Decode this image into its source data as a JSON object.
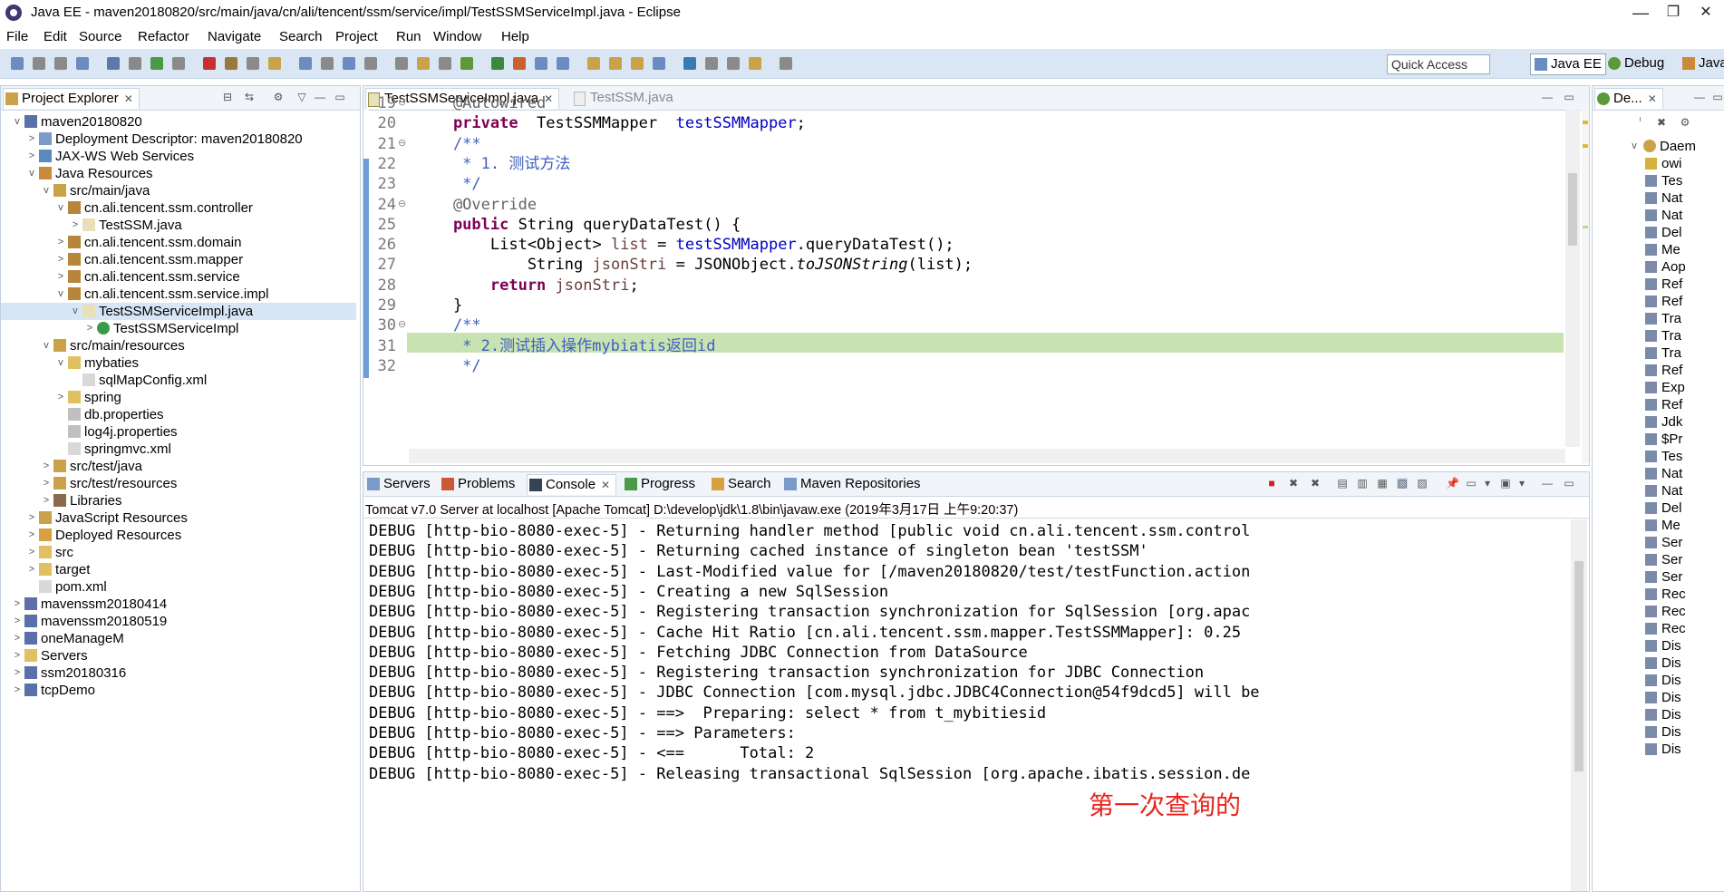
{
  "window": {
    "title": "Java EE - maven20180820/src/main/java/cn/ali/tencent/ssm/service/impl/TestSSMServiceImpl.java - Eclipse",
    "min": "—",
    "max": "❐",
    "close": "✕"
  },
  "menubar": [
    "File",
    "Edit",
    "Source",
    "Refactor",
    "Navigate",
    "Search",
    "Project",
    "Run",
    "Window",
    "Help"
  ],
  "toolbar": {
    "quick_access_placeholder": "Quick Access",
    "perspectives": [
      "Java EE",
      "Debug",
      "Java"
    ]
  },
  "explorer": {
    "title": "Project Explorer",
    "nodes": [
      {
        "label": "maven20180820",
        "depth": 0,
        "expand": "v",
        "icon": "project-icon"
      },
      {
        "label": "Deployment Descriptor: maven20180820",
        "depth": 1,
        "expand": ">",
        "icon": "deployment-icon"
      },
      {
        "label": "JAX-WS Web Services",
        "depth": 1,
        "expand": ">",
        "icon": "webservice-icon"
      },
      {
        "label": "Java Resources",
        "depth": 1,
        "expand": "v",
        "icon": "java-resources-icon"
      },
      {
        "label": "src/main/java",
        "depth": 2,
        "expand": "v",
        "icon": "source-folder-icon"
      },
      {
        "label": "cn.ali.tencent.ssm.controller",
        "depth": 3,
        "expand": "v",
        "icon": "package-icon"
      },
      {
        "label": "TestSSM.java",
        "depth": 4,
        "expand": ">",
        "icon": "java-file-icon"
      },
      {
        "label": "cn.ali.tencent.ssm.domain",
        "depth": 3,
        "expand": ">",
        "icon": "package-icon"
      },
      {
        "label": "cn.ali.tencent.ssm.mapper",
        "depth": 3,
        "expand": ">",
        "icon": "package-icon"
      },
      {
        "label": "cn.ali.tencent.ssm.service",
        "depth": 3,
        "expand": ">",
        "icon": "package-icon"
      },
      {
        "label": "cn.ali.tencent.ssm.service.impl",
        "depth": 3,
        "expand": "v",
        "icon": "package-icon"
      },
      {
        "label": "TestSSMServiceImpl.java",
        "depth": 4,
        "expand": "v",
        "icon": "java-file-icon",
        "selected": true
      },
      {
        "label": "TestSSMServiceImpl",
        "depth": 5,
        "expand": ">",
        "icon": "class-icon"
      },
      {
        "label": "src/main/resources",
        "depth": 2,
        "expand": "v",
        "icon": "source-folder-icon"
      },
      {
        "label": "mybaties",
        "depth": 3,
        "expand": "v",
        "icon": "folder-icon"
      },
      {
        "label": "sqlMapConfig.xml",
        "depth": 4,
        "expand": "",
        "icon": "xml-file-icon"
      },
      {
        "label": "spring",
        "depth": 3,
        "expand": ">",
        "icon": "folder-icon"
      },
      {
        "label": "db.properties",
        "depth": 3,
        "expand": "",
        "icon": "properties-file-icon"
      },
      {
        "label": "log4j.properties",
        "depth": 3,
        "expand": "",
        "icon": "properties-file-icon"
      },
      {
        "label": "springmvc.xml",
        "depth": 3,
        "expand": "",
        "icon": "xml-file-icon"
      },
      {
        "label": "src/test/java",
        "depth": 2,
        "expand": ">",
        "icon": "source-folder-icon"
      },
      {
        "label": "src/test/resources",
        "depth": 2,
        "expand": ">",
        "icon": "source-folder-icon"
      },
      {
        "label": "Libraries",
        "depth": 2,
        "expand": ">",
        "icon": "library-icon"
      },
      {
        "label": "JavaScript Resources",
        "depth": 1,
        "expand": ">",
        "icon": "javascript-icon"
      },
      {
        "label": "Deployed Resources",
        "depth": 1,
        "expand": ">",
        "icon": "deployed-icon"
      },
      {
        "label": "src",
        "depth": 1,
        "expand": ">",
        "icon": "folder-icon"
      },
      {
        "label": "target",
        "depth": 1,
        "expand": ">",
        "icon": "folder-icon"
      },
      {
        "label": "pom.xml",
        "depth": 1,
        "expand": "",
        "icon": "xml-file-icon"
      },
      {
        "label": "mavenssm20180414",
        "depth": 0,
        "expand": ">",
        "icon": "project-icon"
      },
      {
        "label": "mavenssm20180519",
        "depth": 0,
        "expand": ">",
        "icon": "project-icon"
      },
      {
        "label": "oneManageM",
        "depth": 0,
        "expand": ">",
        "icon": "project-icon"
      },
      {
        "label": "Servers",
        "depth": 0,
        "expand": ">",
        "icon": "folder-icon"
      },
      {
        "label": "ssm20180316",
        "depth": 0,
        "expand": ">",
        "icon": "project-icon"
      },
      {
        "label": "tcpDemo",
        "depth": 0,
        "expand": ">",
        "icon": "project-icon"
      }
    ]
  },
  "editor": {
    "tabs": [
      {
        "label": "TestSSMServiceImpl.java",
        "close": "✕",
        "active": true
      },
      {
        "label": "TestSSM.java",
        "close": "",
        "active": false
      }
    ],
    "lines": [
      {
        "n": "19",
        "fold": "⊖",
        "segs": [
          [
            "ann",
            "    @Autowired"
          ]
        ]
      },
      {
        "n": "20",
        "fold": "",
        "segs": [
          [
            "kw",
            "    private"
          ],
          [
            "",
            "  TestSSMMapper  "
          ],
          [
            "fld",
            "testSSMMapper"
          ],
          [
            "",
            ";"
          ]
        ]
      },
      {
        "n": "21",
        "fold": "⊖",
        "segs": [
          [
            "cmt",
            "    /**"
          ]
        ]
      },
      {
        "n": "22",
        "fold": "",
        "segs": [
          [
            "cmt",
            "     * 1. 测试方法"
          ]
        ]
      },
      {
        "n": "23",
        "fold": "",
        "segs": [
          [
            "cmt",
            "     */"
          ]
        ]
      },
      {
        "n": "24",
        "fold": "⊖",
        "segs": [
          [
            "ann",
            "    @Override"
          ]
        ]
      },
      {
        "n": "25",
        "fold": "",
        "segs": [
          [
            "kw",
            "    public"
          ],
          [
            "",
            " String queryDataTest() {"
          ]
        ]
      },
      {
        "n": "26",
        "fold": "",
        "segs": [
          [
            "",
            "        List<Object> "
          ],
          [
            "lvar",
            "list"
          ],
          [
            "",
            " = "
          ],
          [
            "fld",
            "testSSMMapper"
          ],
          [
            "",
            ".queryDataTest();"
          ]
        ]
      },
      {
        "n": "27",
        "fold": "",
        "segs": [
          [
            "",
            "            String "
          ],
          [
            "lvar",
            "jsonStri"
          ],
          [
            "",
            " = JSONObject."
          ],
          [
            "sta",
            "toJSONString"
          ],
          [
            "",
            "(list);"
          ]
        ]
      },
      {
        "n": "28",
        "fold": "",
        "segs": [
          [
            "kw",
            "        return"
          ],
          [
            "",
            " "
          ],
          [
            "lvar",
            "jsonStri"
          ],
          [
            "",
            ";"
          ]
        ]
      },
      {
        "n": "29",
        "fold": "",
        "segs": [
          [
            "",
            "    }"
          ]
        ]
      },
      {
        "n": "30",
        "fold": "⊖",
        "segs": [
          [
            "cmt",
            "    /**"
          ]
        ]
      },
      {
        "n": "31",
        "fold": "",
        "segs": [
          [
            "cmt",
            "     * 2.测试插入操作mybiatis返回id"
          ]
        ]
      },
      {
        "n": "32",
        "fold": "",
        "segs": [
          [
            "cmt",
            "     */"
          ]
        ]
      }
    ]
  },
  "bottom": {
    "tabs": [
      "Servers",
      "Problems",
      "Console",
      "Progress",
      "Search",
      "Maven Repositories"
    ],
    "active_tab": "Console",
    "console_header": "Tomcat v7.0 Server at localhost [Apache Tomcat] D:\\develop\\jdk\\1.8\\bin\\javaw.exe (2019年3月17日 上午9:20:37)",
    "lines": [
      "DEBUG [http-bio-8080-exec-5] - Returning handler method [public void cn.ali.tencent.ssm.control",
      "DEBUG [http-bio-8080-exec-5] - Returning cached instance of singleton bean 'testSSM'",
      "DEBUG [http-bio-8080-exec-5] - Last-Modified value for [/maven20180820/test/testFunction.action",
      "DEBUG [http-bio-8080-exec-5] - Creating a new SqlSession",
      "DEBUG [http-bio-8080-exec-5] - Registering transaction synchronization for SqlSession [org.apac",
      "DEBUG [http-bio-8080-exec-5] - Cache Hit Ratio [cn.ali.tencent.ssm.mapper.TestSSMMapper]: 0.25",
      "DEBUG [http-bio-8080-exec-5] - Fetching JDBC Connection from DataSource",
      "DEBUG [http-bio-8080-exec-5] - Registering transaction synchronization for JDBC Connection",
      "DEBUG [http-bio-8080-exec-5] - JDBC Connection [com.mysql.jdbc.JDBC4Connection@54f9dcd5] will be",
      "DEBUG [http-bio-8080-exec-5] - ==>  Preparing: select * from t_mybitiesid",
      "DEBUG [http-bio-8080-exec-5] - ==> Parameters: ",
      "DEBUG [http-bio-8080-exec-5] - <==      Total: 2",
      "DEBUG [http-bio-8080-exec-5] - Releasing transactional SqlSession [org.apache.ibatis.session.de"
    ],
    "annotation": "第一次查询的",
    "annotation_color": "#e8261f"
  },
  "debug_view": {
    "title": "De...",
    "root": "Daem",
    "items": [
      "owi",
      "Tes",
      "Nat",
      "Nat",
      "Del",
      "Me",
      "Aop",
      "Ref",
      "Ref",
      "Tra",
      "Tra",
      "Tra",
      "Ref",
      "Exp",
      "Ref",
      "Jdk",
      "$Pr",
      "Tes",
      "Nat",
      "Nat",
      "Del",
      "Me",
      "Ser",
      "Ser",
      "Ser",
      "Rec",
      "Rec",
      "Rec",
      "Dis",
      "Dis",
      "Dis",
      "Dis",
      "Dis",
      "Dis",
      "Dis"
    ]
  },
  "colors": {
    "toolbar": "#dae6f3",
    "selection": "#d7e6f7",
    "current_line": "#c8e3b1"
  }
}
